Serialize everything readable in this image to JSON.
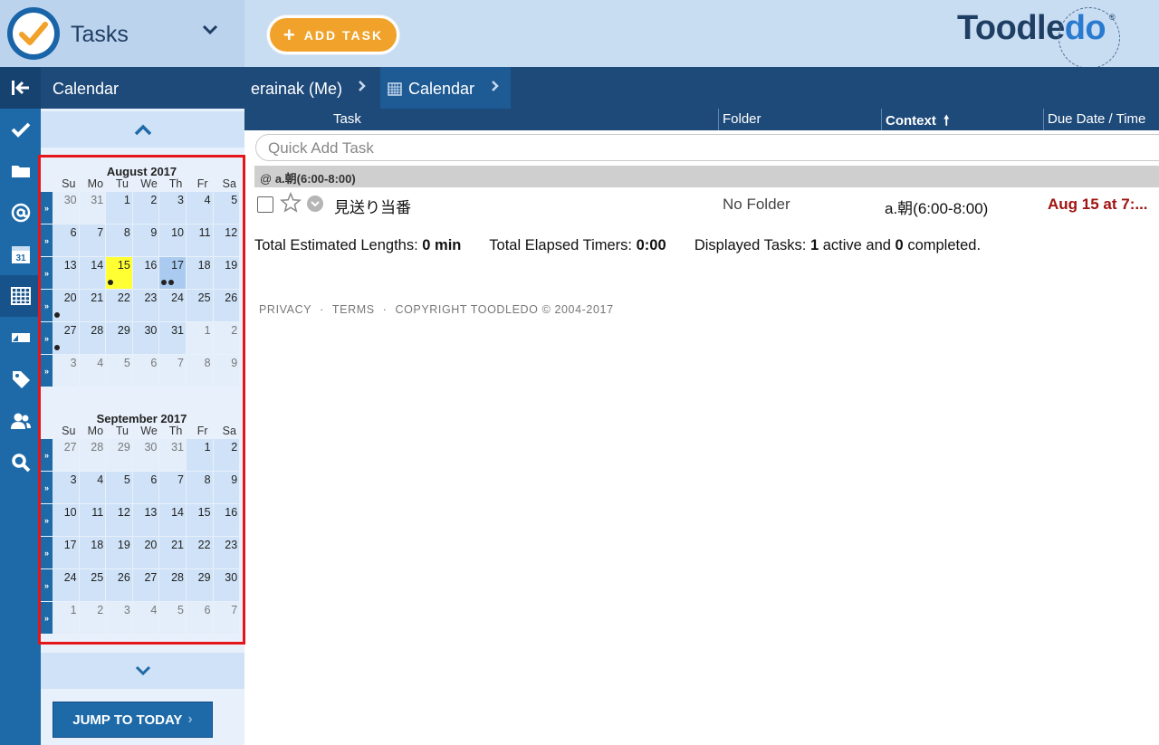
{
  "app": {
    "title": "Tasks",
    "add_task_label": "ADD TASK",
    "brand_main": "Toodle",
    "brand_accent": "do",
    "brand_reg": "®"
  },
  "sidebar": {
    "header": "Calendar",
    "jump_label": "JUMP TO TODAY",
    "months": [
      {
        "title": "August 2017",
        "days_of_week": [
          "Su",
          "Mo",
          "Tu",
          "We",
          "Th",
          "Fr",
          "Sa"
        ],
        "weeks": [
          [
            "30",
            "31",
            "1",
            "2",
            "3",
            "4",
            "5"
          ],
          [
            "6",
            "7",
            "8",
            "9",
            "10",
            "11",
            "12"
          ],
          [
            "13",
            "14",
            "15",
            "16",
            "17",
            "18",
            "19"
          ],
          [
            "20",
            "21",
            "22",
            "23",
            "24",
            "25",
            "26"
          ],
          [
            "27",
            "28",
            "29",
            "30",
            "31",
            "1",
            "2"
          ],
          [
            "3",
            "4",
            "5",
            "6",
            "7",
            "8",
            "9"
          ]
        ]
      },
      {
        "title": "September 2017",
        "days_of_week": [
          "Su",
          "Mo",
          "Tu",
          "We",
          "Th",
          "Fr",
          "Sa"
        ],
        "weeks": [
          [
            "27",
            "28",
            "29",
            "30",
            "31",
            "1",
            "2"
          ],
          [
            "3",
            "4",
            "5",
            "6",
            "7",
            "8",
            "9"
          ],
          [
            "10",
            "11",
            "12",
            "13",
            "14",
            "15",
            "16"
          ],
          [
            "17",
            "18",
            "19",
            "20",
            "21",
            "22",
            "23"
          ],
          [
            "24",
            "25",
            "26",
            "27",
            "28",
            "29",
            "30"
          ],
          [
            "1",
            "2",
            "3",
            "4",
            "5",
            "6",
            "7"
          ]
        ]
      }
    ]
  },
  "breadcrumb": {
    "user": "erainak (Me)",
    "view": "Calendar"
  },
  "columns": {
    "task": "Task",
    "folder": "Folder",
    "context": "Context",
    "due": "Due Date / Time"
  },
  "quick_add_placeholder": "Quick Add Task",
  "group": {
    "prefix": "@",
    "name": "a.朝(6:00-8:00)"
  },
  "task": {
    "name": "見送り当番",
    "folder": "No Folder",
    "context": "a.朝(6:00-8:00)",
    "due": "Aug 15 at 7:..."
  },
  "totals": {
    "estimated_label": "Total Estimated Lengths:",
    "estimated_value": "0 min",
    "elapsed_label": "Total Elapsed Timers:",
    "elapsed_value": "0:00",
    "displayed_label": "Displayed Tasks:",
    "active_count": "1",
    "active_label": "active and",
    "completed_count": "0",
    "completed_label": "completed."
  },
  "footer": {
    "privacy": "PRIVACY",
    "terms": "TERMS",
    "copyright": "COPYRIGHT TOODLEDO © 2004-2017"
  },
  "colors": {
    "accent_orange": "#f0a22a",
    "nav_blue": "#1e4a7a",
    "rail_blue": "#1e6aa8",
    "today_yellow": "#ffff33",
    "due_red": "#a0130f",
    "highlight_red": "#e4151b"
  }
}
